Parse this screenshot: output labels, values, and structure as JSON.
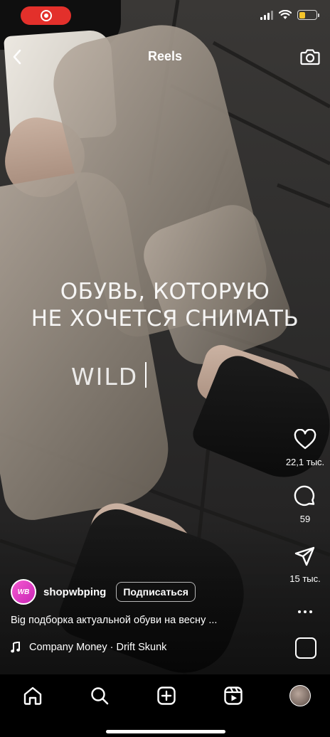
{
  "status_bar": {
    "recording_indicator": "record-icon",
    "battery_color": "#f5c52b",
    "record_color": "#e3302b"
  },
  "header": {
    "title": "Reels",
    "back_icon": "chevron-left-icon",
    "camera_icon": "camera-icon"
  },
  "video_overlay": {
    "line1": "ОБУВЬ, КОТОРУЮ",
    "line2": "НЕ ХОЧЕТСЯ СНИМАТЬ",
    "brand": "WILD"
  },
  "actions": {
    "likes": "22,1 тыс.",
    "comments": "59",
    "shares": "15 тыс."
  },
  "post": {
    "avatar_text": "WB",
    "username": "shopwbping",
    "follow_label": "Подписаться",
    "caption": "Big подборка актуальной обуви на весну ...",
    "audio": "Company Money · Drift Skunk"
  },
  "bottom_nav": {
    "items": [
      "home-icon",
      "search-icon",
      "create-icon",
      "reels-icon",
      "profile-avatar"
    ]
  }
}
